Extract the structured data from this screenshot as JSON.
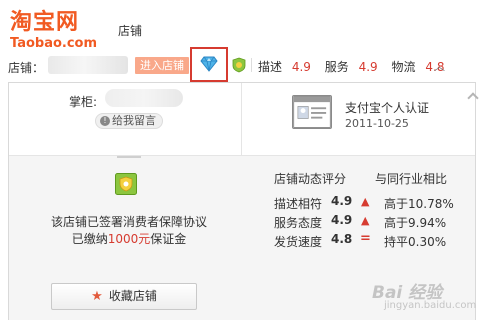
{
  "header": {
    "logo_cn": "淘宝网",
    "logo_en": "Taobao.com",
    "site_label": "店铺",
    "store_label": "店铺：",
    "enter_store": "进入店铺",
    "ratings": [
      {
        "label": "描述",
        "value": "4.9"
      },
      {
        "label": "服务",
        "value": "4.9"
      },
      {
        "label": "物流",
        "value": "4.8"
      }
    ],
    "expand_icon": "chevron-up-icon"
  },
  "panel": {
    "keeper_label": "掌柜:",
    "leave_message": "给我留言",
    "alipay_title": "支付宝个人认证",
    "alipay_date": "2011-10-25",
    "signed_line1": "该店铺已签署消费者保障协议",
    "signed_line2_prefix": "已缴纳",
    "signed_amount": "1000元",
    "signed_line2_suffix": "保证金",
    "score_title": "店铺动态评分",
    "compare_title": "与同行业相比",
    "scores": [
      {
        "label": "描述相符",
        "value": "4.9",
        "trend": "up",
        "compare": "高于10.78%"
      },
      {
        "label": "服务态度",
        "value": "4.9",
        "trend": "up",
        "compare": "高于9.94%"
      },
      {
        "label": "发货速度",
        "value": "4.8",
        "trend": "equal",
        "compare": "持平0.30%"
      }
    ],
    "favorite_button": "收藏店铺"
  },
  "watermark": {
    "main": "Bai 经验",
    "sub": "jingyan.baidu.com"
  },
  "colors": {
    "brand_orange": "#f15a22",
    "enter_button": "#f9a88a",
    "highlight_red": "#d63b30",
    "panel_bg": "#f5f5f5"
  }
}
